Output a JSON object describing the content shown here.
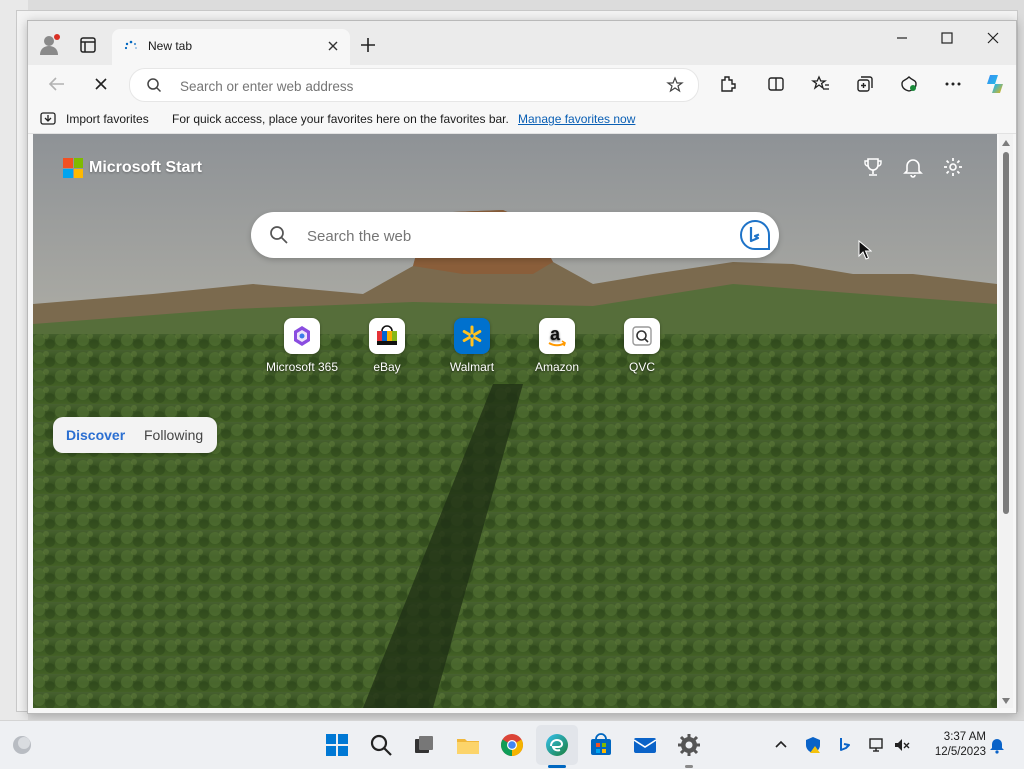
{
  "browser": {
    "tab_title": "New tab",
    "address_placeholder": "Search or enter web address",
    "favorites_bar": {
      "import_label": "Import favorites",
      "message": "For quick access, place your favorites here on the favorites bar.",
      "manage_link": "Manage favorites now"
    }
  },
  "newtab": {
    "brand": "Microsoft Start",
    "search_placeholder": "Search the web",
    "quick_links": [
      {
        "label": "Microsoft 365",
        "icon": "microsoft-365-icon"
      },
      {
        "label": "eBay",
        "icon": "ebay-icon"
      },
      {
        "label": "Walmart",
        "icon": "walmart-icon"
      },
      {
        "label": "Amazon",
        "icon": "amazon-icon"
      },
      {
        "label": "QVC",
        "icon": "qvc-icon"
      }
    ],
    "feed_tabs": [
      "Discover",
      "Following"
    ]
  },
  "taskbar": {
    "time": "3:37 AM",
    "date": "12/5/2023"
  },
  "colors": {
    "accent": "#0067c0",
    "link": "#0a5fb4",
    "feed_active": "#2b6fd1"
  }
}
